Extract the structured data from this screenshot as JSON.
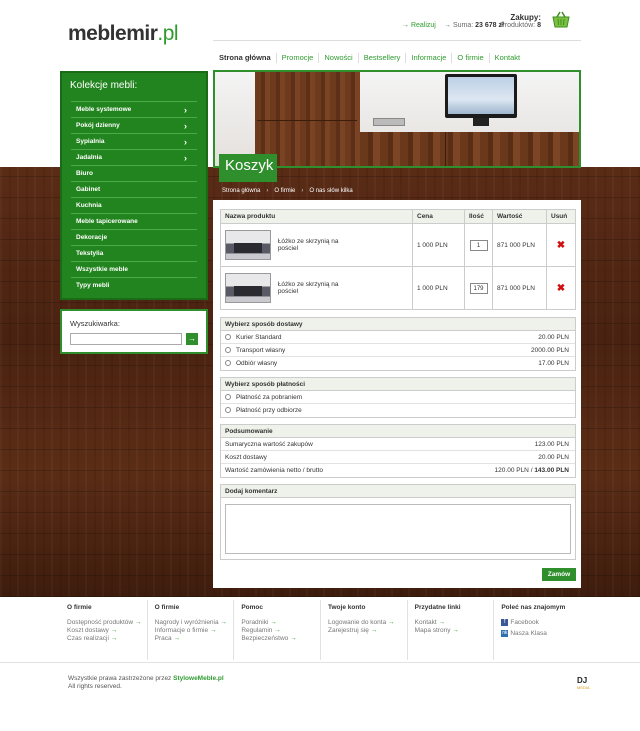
{
  "header": {
    "logo_main": "meblemir",
    "logo_tld": ".pl",
    "cart_title": "Zakupy:",
    "cart_realizuj": "Realizuj",
    "cart_suma_label": "Suma:",
    "cart_suma_value": "23 678 zł",
    "cart_produkty_label": "Produktów:",
    "cart_produkty_value": "8"
  },
  "nav": [
    "Strona główna",
    "Promocje",
    "Nowości",
    "Bestsellery",
    "Informacje",
    "O firmie",
    "Kontakt"
  ],
  "sidebar": {
    "title": "Kolekcje mebli:",
    "items": [
      {
        "label": "Meble systemowe",
        "arrow": true
      },
      {
        "label": "Pokój dzienny",
        "arrow": true
      },
      {
        "label": "Sypialnia",
        "arrow": true
      },
      {
        "label": "Jadalnia",
        "arrow": true
      },
      {
        "label": "Biuro",
        "arrow": false
      },
      {
        "label": "Gabinet",
        "arrow": false
      },
      {
        "label": "Kuchnia",
        "arrow": false
      },
      {
        "label": "Meble tapicerowane",
        "arrow": false
      },
      {
        "label": "Dekoracje",
        "arrow": false
      },
      {
        "label": "Tekstylia",
        "arrow": false
      },
      {
        "label": "Wszystkie meble",
        "arrow": false
      },
      {
        "label": "Typy mebli",
        "arrow": false
      }
    ]
  },
  "search": {
    "label": "Wyszukiwarka:",
    "button": "→"
  },
  "page_title": "Koszyk",
  "breadcrumb": [
    "Strona główna",
    "O firmie",
    "O nas słów kilka"
  ],
  "cart_table": {
    "headers": [
      "Nazwa produktu",
      "Cena",
      "Ilość",
      "Wartość",
      "Usuń"
    ],
    "rows": [
      {
        "name": "Łóżko ze skrzynią na pościel",
        "price": "1 000 PLN",
        "qty": "1",
        "value": "871 000 PLN"
      },
      {
        "name": "Łóżko ze skrzynią na pościel",
        "price": "1 000 PLN",
        "qty": "179",
        "value": "871 000 PLN"
      }
    ]
  },
  "shipping": {
    "title": "Wybierz sposób dostawy",
    "options": [
      {
        "label": "Kurier Standard",
        "price": "20.00 PLN"
      },
      {
        "label": "Transport własny",
        "price": "2000.00 PLN"
      },
      {
        "label": "Odbiór własny",
        "price": "17.00 PLN"
      }
    ]
  },
  "payment": {
    "title": "Wybierz sposób płatności",
    "options": [
      "Płatność za pobraniem",
      "Płatność przy odbiorze"
    ]
  },
  "summary": {
    "title": "Podsumowanie",
    "rows": [
      {
        "label": "Sumaryczna wartość zakupów",
        "value": "123.00 PLN"
      },
      {
        "label": "Koszt dostawy",
        "value": "20.00 PLN"
      }
    ],
    "total_label": "Wartość zamówienia netto / brutto",
    "total_net": "120.00 PLN",
    "total_sep": " / ",
    "total_gross": "143.00 PLN"
  },
  "comment": {
    "title": "Dodaj komentarz"
  },
  "order_button": "Zamów",
  "footer": {
    "columns": [
      {
        "title": "O firmie",
        "links": [
          "Dostępność produktów",
          "Koszt dostawy",
          "Czas realizacji"
        ]
      },
      {
        "title": "O firmie",
        "links": [
          "Nagrody i wyróżnienia",
          "Informacje o firmie",
          "Praca"
        ]
      },
      {
        "title": "Pomoc",
        "links": [
          "Poradniki",
          "Regulamin",
          "Bezpieczeństwo"
        ]
      },
      {
        "title": "Twoje konto",
        "links": [
          "Logowanie do konta",
          "Zarejestruj się"
        ]
      },
      {
        "title": "Przydatne linki",
        "links": [
          "Kontakt",
          "Mapa strony"
        ]
      }
    ],
    "social_title": "Poleć nas znajomym",
    "social": [
      "Facebook",
      "Nasza Klasa"
    ],
    "copyright_prefix": "Wszystkie prawa zastrzeżone przez",
    "copyright_brand": "StyloweMeble.pl",
    "copyright_line2": "All rights reserved.",
    "credit": "DJ",
    "credit_sub": "MEDIA"
  }
}
